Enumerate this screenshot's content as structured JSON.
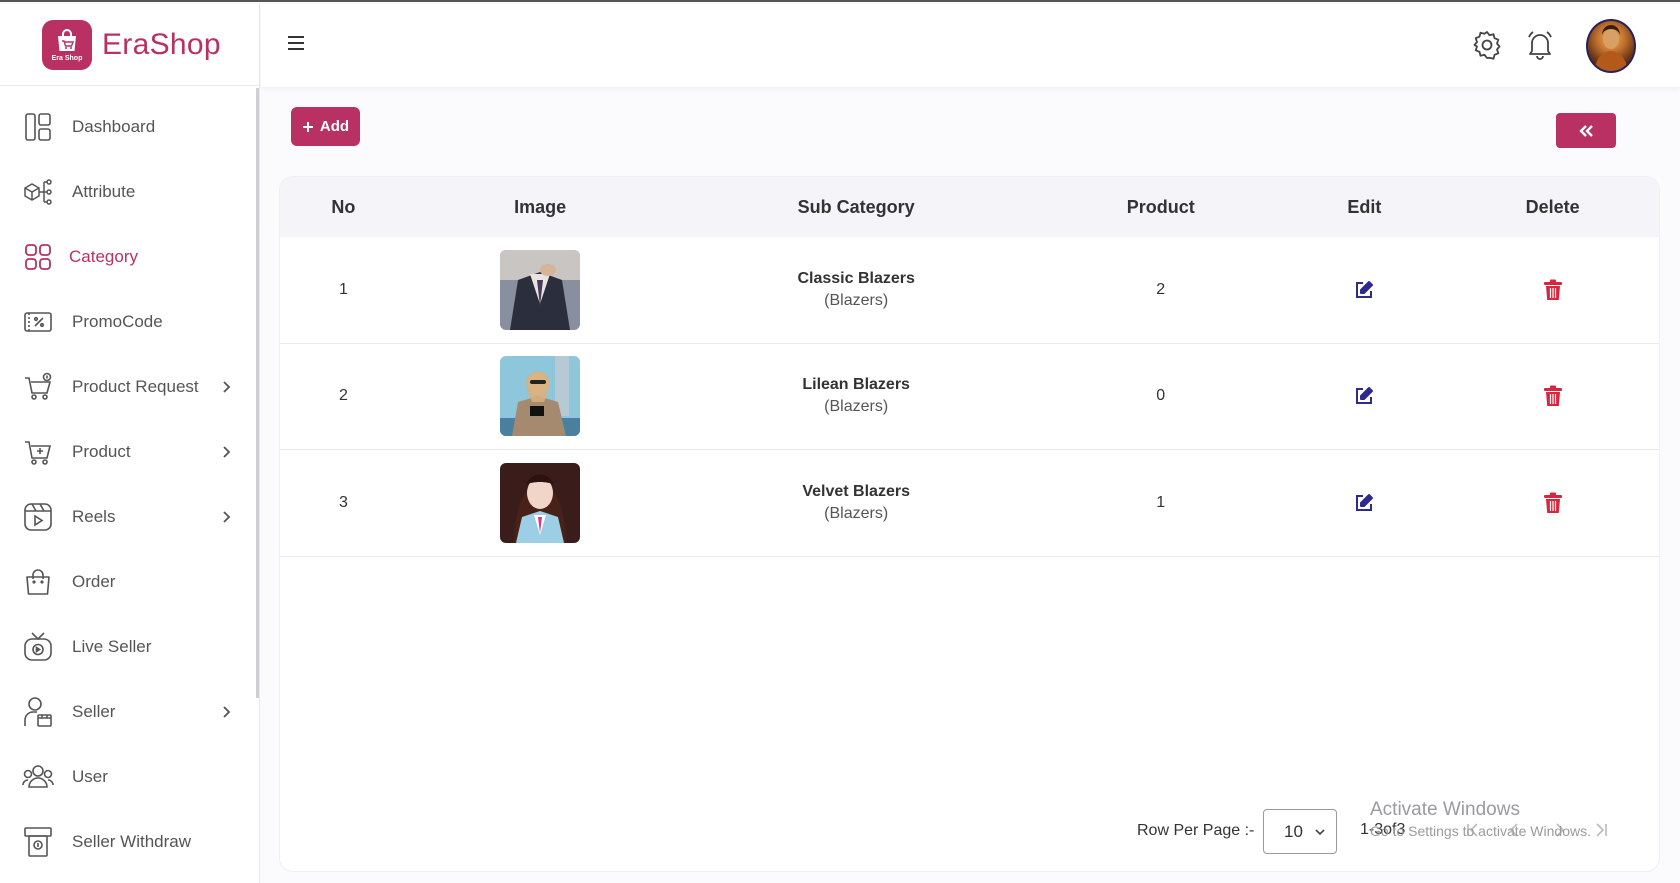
{
  "brand": {
    "name": "EraShop",
    "logo_text": "Era Shop",
    "accent": "#b93163"
  },
  "sidebar": {
    "items": [
      {
        "label": "Dashboard",
        "icon": "dashboard-icon",
        "has_submenu": false
      },
      {
        "label": "Attribute",
        "icon": "attribute-icon",
        "has_submenu": false
      },
      {
        "label": "Category",
        "icon": "category-icon",
        "has_submenu": false,
        "active": true
      },
      {
        "label": "PromoCode",
        "icon": "promocode-icon",
        "has_submenu": false
      },
      {
        "label": "Product Request",
        "icon": "cart-request-icon",
        "has_submenu": true
      },
      {
        "label": "Product",
        "icon": "cart-add-icon",
        "has_submenu": true
      },
      {
        "label": "Reels",
        "icon": "reels-icon",
        "has_submenu": true
      },
      {
        "label": "Order",
        "icon": "shopping-bag-icon",
        "has_submenu": false
      },
      {
        "label": "Live Seller",
        "icon": "tv-icon",
        "has_submenu": false
      },
      {
        "label": "Seller",
        "icon": "seller-icon",
        "has_submenu": true
      },
      {
        "label": "User",
        "icon": "users-icon",
        "has_submenu": false
      },
      {
        "label": "Seller Withdraw",
        "icon": "withdraw-icon",
        "has_submenu": false
      }
    ]
  },
  "header": {
    "icons": [
      "hamburger-icon",
      "settings-icon",
      "bell-icon",
      "avatar"
    ]
  },
  "toolbar": {
    "add_label": "Add"
  },
  "table": {
    "columns": [
      "No",
      "Image",
      "Sub Category",
      "Product",
      "Edit",
      "Delete"
    ],
    "rows": [
      {
        "no": "1",
        "name": "Classic Blazers",
        "parent": "(Blazers)",
        "product": "2"
      },
      {
        "no": "2",
        "name": "Lilean Blazers",
        "parent": "(Blazers)",
        "product": "0"
      },
      {
        "no": "3",
        "name": "Velvet Blazers",
        "parent": "(Blazers)",
        "product": "1"
      }
    ]
  },
  "pagination": {
    "row_per_page_label": "Row Per Page :-",
    "rows_per_page": "10",
    "range": "1-3of3"
  },
  "watermark": {
    "title": "Activate Windows",
    "subtitle": "Go to Settings to activate Windows."
  },
  "colors": {
    "accent": "#b93163",
    "edit": "#2e2b8f",
    "delete": "#d7263d"
  }
}
